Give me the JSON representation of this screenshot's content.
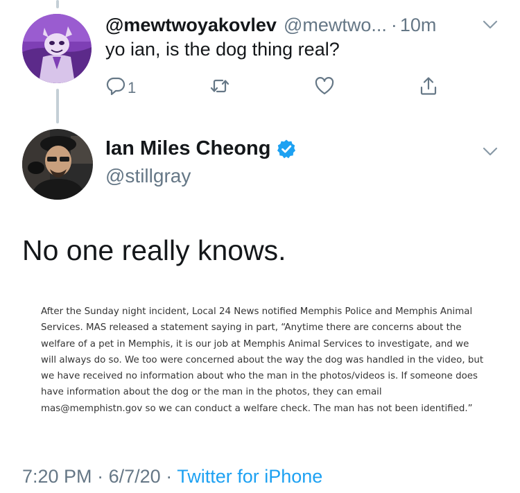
{
  "reply_tweet": {
    "display_name": "@mewtwoyakovlev",
    "handle": "@mewtwo...",
    "separator": "·",
    "time_ago": "10m",
    "text": "yo ian, is the dog thing real?",
    "reply_count": "1",
    "icons": [
      "reply-icon",
      "retweet-icon",
      "like-icon",
      "share-icon",
      "chevron-down-icon"
    ]
  },
  "main_tweet": {
    "display_name": "Ian Miles Cheong",
    "handle": "@stillgray",
    "verified": true,
    "text": "No one really knows.",
    "image_text": "After the Sunday night incident, Local 24 News notified Memphis Police and Memphis Animal Services. MAS released a statement saying in part, “Anytime there are concerns about the welfare of a pet in Memphis, it is our job at Memphis Animal Services to investigate, and we will always do so. We too were concerned about the way the dog was handled in the video, but we have received no information about who the man in the photos/videos is. If someone does have information about the dog or the man in the photos, they can email mas@memphistn.gov so we can conduct a welfare check. The man has not been identified.”",
    "time": "7:20 PM",
    "date": "6/7/20",
    "separator": "·",
    "source": "Twitter for iPhone"
  },
  "colors": {
    "text": "#14171a",
    "secondary": "#657786",
    "accent": "#1da1f2",
    "thread_line": "#c4cfd6"
  }
}
